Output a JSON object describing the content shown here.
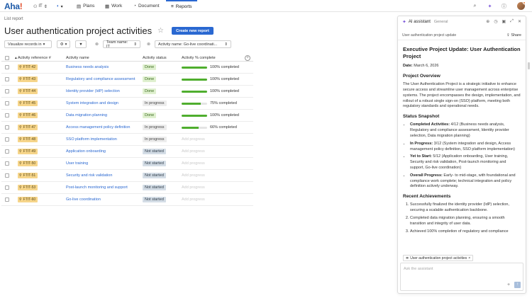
{
  "nav": {
    "logo": "Aha",
    "logo_bang": "!",
    "workspace": "IT",
    "tabs": [
      {
        "label": "Plans",
        "icon": "calendar-icon"
      },
      {
        "label": "Work",
        "icon": "grid-icon"
      },
      {
        "label": "Document",
        "icon": "document-icon"
      },
      {
        "label": "Reports",
        "icon": "reports-icon",
        "active": true
      }
    ]
  },
  "header": {
    "breadcrumb": "List report",
    "title": "User authentication project activities",
    "create_button": "Create new report"
  },
  "filters": {
    "visualize": "Visualize records in",
    "team_filter": "Team name: IT",
    "activity_filter": "Activity name: Go-live coordinati..."
  },
  "table": {
    "headers": {
      "ref": "Activity reference #",
      "name": "Activity name",
      "status": "Activity status",
      "pct": "Activity % complete"
    },
    "add_progress_label": "Add progress",
    "rows": [
      {
        "ref": "FTIT-42",
        "name": "Business needs analysis",
        "status": "Done",
        "status_type": "done",
        "pct": 100,
        "pct_text": "100% completed"
      },
      {
        "ref": "FTIT-43",
        "name": "Regulatory and compliance assessment",
        "status": "Done",
        "status_type": "done",
        "pct": 100,
        "pct_text": "100% completed"
      },
      {
        "ref": "FTIT-44",
        "name": "Identity provider (IdP) selection",
        "status": "Done",
        "status_type": "done",
        "pct": 100,
        "pct_text": "100% completed"
      },
      {
        "ref": "FTIT-45",
        "name": "System integration and design",
        "status": "In progress",
        "status_type": "prog",
        "pct": 75,
        "pct_text": "75% completed"
      },
      {
        "ref": "FTIT-46",
        "name": "Data migration planning",
        "status": "Done",
        "status_type": "done",
        "pct": 100,
        "pct_text": "100% completed"
      },
      {
        "ref": "FTIT-47",
        "name": "Access management policy definition",
        "status": "In progress",
        "status_type": "prog",
        "pct": 66,
        "pct_text": "66% completed"
      },
      {
        "ref": "FTIT-48",
        "name": "SSO platform implementation",
        "status": "In progress",
        "status_type": "prog",
        "pct": null,
        "pct_text": ""
      },
      {
        "ref": "FTIT-49",
        "name": "Application onboarding",
        "status": "Not started",
        "status_type": "not",
        "pct": null,
        "pct_text": ""
      },
      {
        "ref": "FTIT-50",
        "name": "User training",
        "status": "Not started",
        "status_type": "not",
        "pct": null,
        "pct_text": ""
      },
      {
        "ref": "FTIT-51",
        "name": "Security and risk validation",
        "status": "Not started",
        "status_type": "not",
        "pct": null,
        "pct_text": ""
      },
      {
        "ref": "FTIT-53",
        "name": "Post-launch monitoring and support",
        "status": "Not started",
        "status_type": "not",
        "pct": null,
        "pct_text": ""
      },
      {
        "ref": "FTIT-60",
        "name": "Go-live coordination",
        "status": "Not started",
        "status_type": "not",
        "pct": null,
        "pct_text": ""
      }
    ]
  },
  "assistant": {
    "title": "AI assistant",
    "tag": "General",
    "subtitle": "User authentication project update",
    "share": "Share",
    "doc_title": "Executive Project Update: User Authentication Project",
    "date_label": "Date:",
    "date_value": "March 6, 2026",
    "overview_heading": "Project Overview",
    "overview_text": "The User Authentication Project is a strategic initiative to enhance secure access and streamline user management across enterprise systems. The project encompasses the design, implementation, and rollout of a robust single sign-on (SSO) platform, meeting both regulatory standards and operational needs.",
    "snapshot_heading": "Status Snapshot",
    "snapshot": [
      {
        "label": "Completed Activities:",
        "text": " 4/12 (Business needs analysis, Regulatory and compliance assessment, Identity provider selection, Data migration planning)"
      },
      {
        "label": "In Progress:",
        "text": " 3/12 (System integration and design, Access management policy definition, SSO platform implementation)"
      },
      {
        "label": "Yet to Start:",
        "text": " 5/12 (Application onboarding, User training, Security and risk validation, Post-launch monitoring and support, Go-live coordination)"
      },
      {
        "label": "Overall Progress:",
        "text": " Early- to mid-stage, with foundational and compliance work complete; technical integration and policy definition actively underway."
      }
    ],
    "achievements_heading": "Recent Achievements",
    "achievements": [
      "Successfully finalized the identity provider (IdP) selection, securing a scalable authentication backbone.",
      "Completed data migration planning, ensuring a smooth transition and integrity of user data.",
      "Achieved 100% completion of regulatory and compliance"
    ],
    "context_chip": "User authentication project activities",
    "input_placeholder": "Ask the assistant",
    "colors": {
      "accent": "#2a68d1",
      "spark": "#7a54d9",
      "done_bg": "#dff0cf",
      "progress_fill": "#4fae2e"
    }
  }
}
